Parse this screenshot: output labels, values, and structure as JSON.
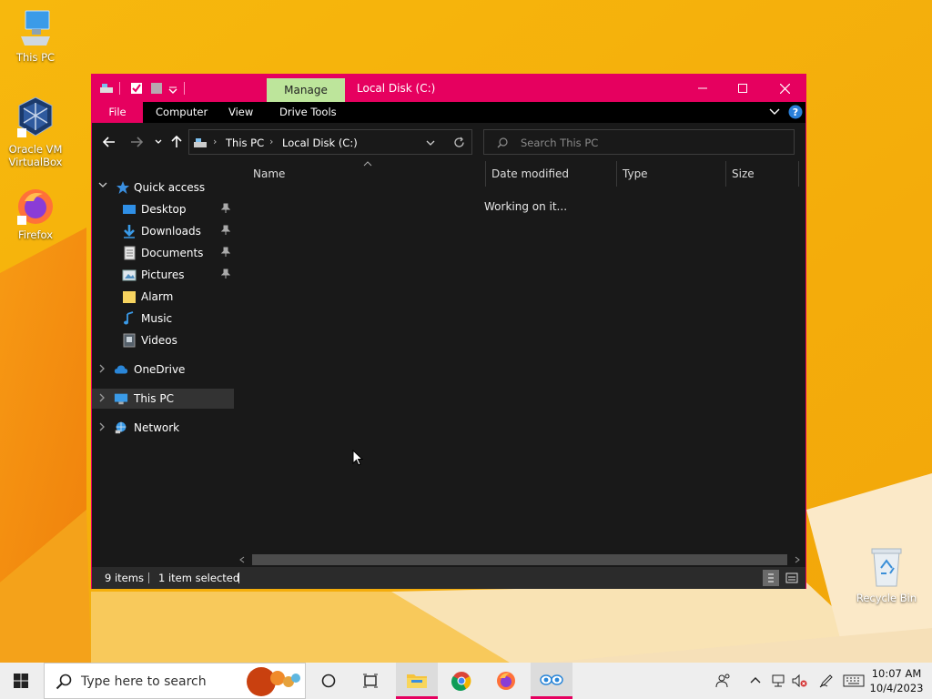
{
  "desktop": {
    "icons": [
      {
        "label": "This PC"
      },
      {
        "label": "Oracle VM VirtualBox"
      },
      {
        "label": "Firefox"
      },
      {
        "label": "Recycle Bin"
      }
    ]
  },
  "window": {
    "title": "Local Disk (C:)",
    "manage_tab": "Manage",
    "accent_color": "#e6005f",
    "ribbon_tabs": [
      "File",
      "Computer",
      "View",
      "Drive Tools"
    ],
    "breadcrumb": [
      "This PC",
      "Local Disk (C:)"
    ],
    "search_placeholder": "Search This PC",
    "nav": {
      "quick_access": "Quick access",
      "quick_items": [
        {
          "label": "Desktop",
          "pinned": true,
          "icon": "desktop-folder-icon"
        },
        {
          "label": "Downloads",
          "pinned": true,
          "icon": "downloads-folder-icon"
        },
        {
          "label": "Documents",
          "pinned": true,
          "icon": "documents-folder-icon"
        },
        {
          "label": "Pictures",
          "pinned": true,
          "icon": "pictures-folder-icon"
        },
        {
          "label": "Alarm",
          "pinned": false,
          "icon": "folder-icon"
        },
        {
          "label": "Music",
          "pinned": false,
          "icon": "music-folder-icon"
        },
        {
          "label": "Videos",
          "pinned": false,
          "icon": "videos-folder-icon"
        }
      ],
      "onedrive": "OneDrive",
      "this_pc": "This PC",
      "network": "Network"
    },
    "columns": [
      "Name",
      "Date modified",
      "Type",
      "Size"
    ],
    "working_message": "Working on it...",
    "status": {
      "items": "9 items",
      "selected": "1 item selected"
    }
  },
  "taskbar": {
    "search_placeholder": "Type here to search",
    "time": "10:07 AM",
    "date": "10/4/2023"
  }
}
